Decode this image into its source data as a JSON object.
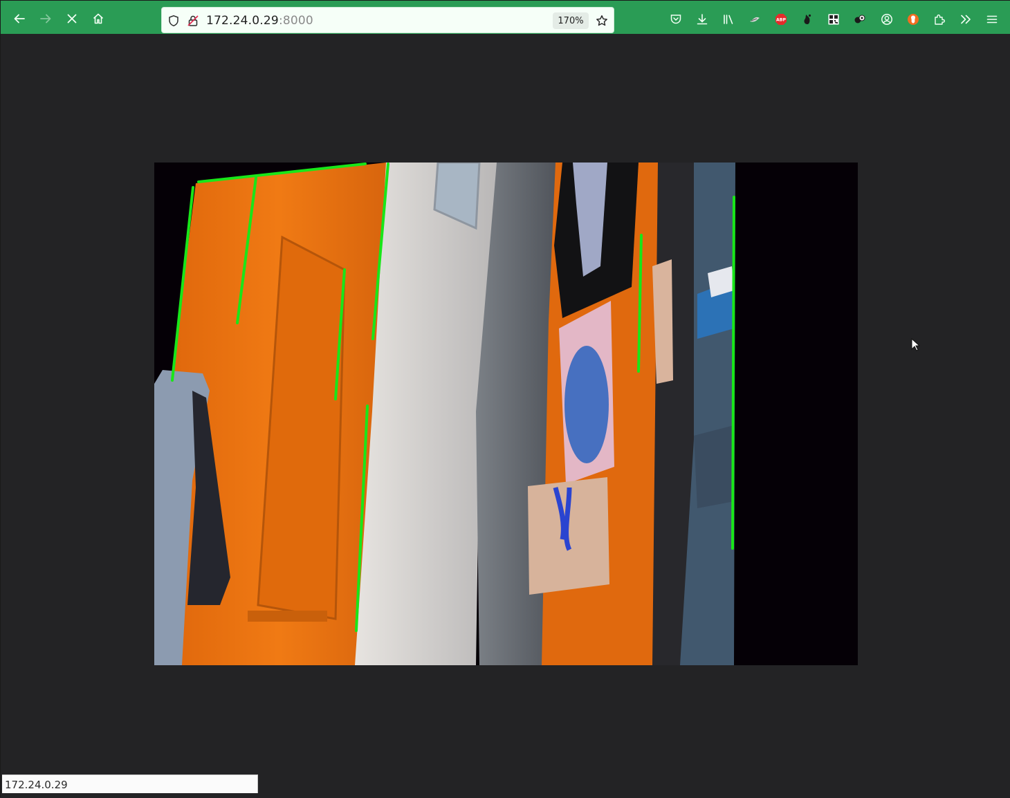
{
  "browser": {
    "url_host": "172.24.0.29",
    "url_port": ":8000",
    "zoom_level": "170%",
    "accent_color": "#2a9c55"
  },
  "toolbar": {
    "icons": [
      "back-icon",
      "forward-icon",
      "stop-icon",
      "home-icon",
      "shield-icon",
      "insecure-lock-icon",
      "bookmark-star-icon",
      "pocket-icon",
      "download-icon",
      "library-icon",
      "extension-icon",
      "adblock-plus-icon",
      "extension-icon",
      "qr-code-icon",
      "extension-icon",
      "account-icon",
      "brave-icon",
      "extensions-puzzle-icon",
      "overflow-chevron-icon",
      "menu-icon"
    ]
  },
  "video": {
    "description": "",
    "line_color": "#19e619"
  },
  "status_bar": {
    "link_text": "172.24.0.29"
  }
}
